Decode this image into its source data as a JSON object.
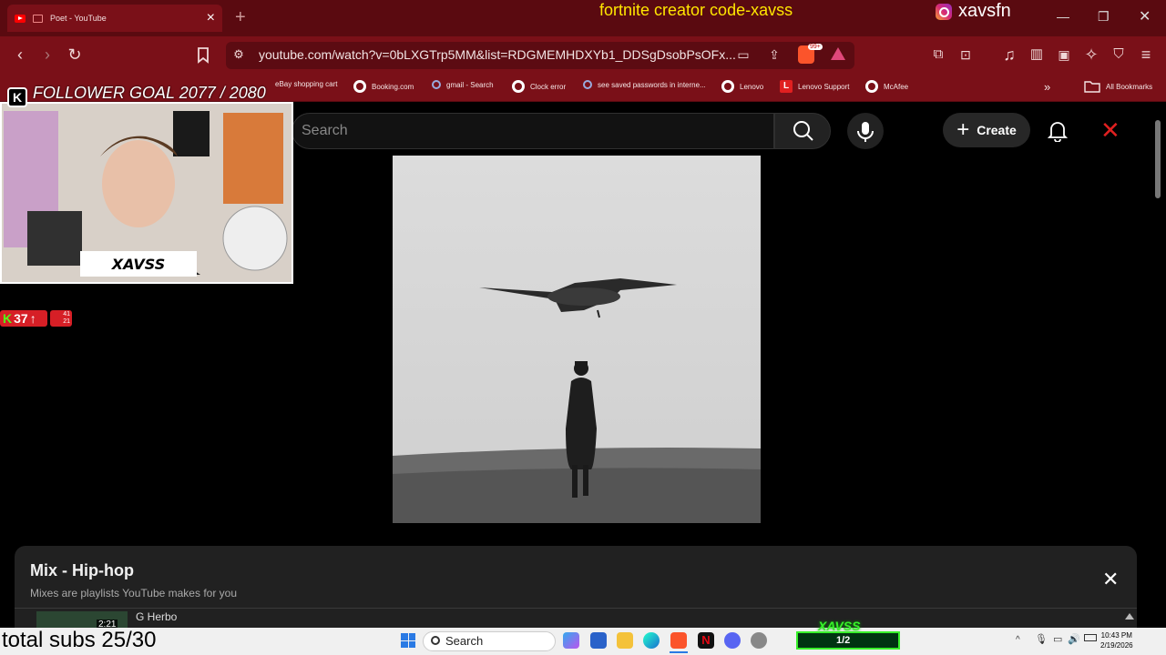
{
  "browser": {
    "tab_title": "Poet - YouTube",
    "url": "youtube.com/watch?v=0bLXGTrp5MM&list=RDGMEMHDXYb1_DDSgDsobPsOFx...",
    "badge": "99+"
  },
  "stream_overlay": {
    "creator_code": "fortnite creator code-xavss",
    "handle": "xavsfn",
    "follower_goal": "FOLLOWER GOAL 2077 / 2080",
    "cam_label": "XAVSS",
    "kick_viewers": "37",
    "kick_stats": [
      "41",
      "21"
    ],
    "total_subs": "total subs 25/30",
    "taskbar_logo": "XAVSS",
    "tab_counter": "1/2"
  },
  "bookmarks": [
    {
      "label": "eBay shopping cart",
      "icon": "globe-icon"
    },
    {
      "label": "Booking.com",
      "icon": "globe-icon"
    },
    {
      "label": "gmail - Search",
      "icon": "search-icon"
    },
    {
      "label": "Clock error",
      "icon": "globe-icon"
    },
    {
      "label": "see saved passwords in interne...",
      "icon": "search-icon"
    },
    {
      "label": "Lenovo",
      "icon": "globe-icon"
    },
    {
      "label": "Lenovo Support",
      "icon": "lenovo-icon"
    },
    {
      "label": "McAfee",
      "icon": "globe-icon"
    }
  ],
  "all_bookmarks": "All Bookmarks",
  "youtube": {
    "search_placeholder": "Search",
    "create_label": "Create"
  },
  "mix": {
    "title": "Mix - Hip-hop",
    "subtitle": "Mixes are playlists YouTube makes for you",
    "first_item": {
      "artist": "G Herbo",
      "duration": "2:21"
    }
  },
  "taskbar": {
    "search_label": "Search",
    "time": "10:43 PM",
    "date": "2/19/2026"
  },
  "colors": {
    "browser_accent": "#7a1018",
    "youtube_bg": "#000000",
    "creator_code": "#ffe600",
    "kick_green": "#53fc18"
  }
}
